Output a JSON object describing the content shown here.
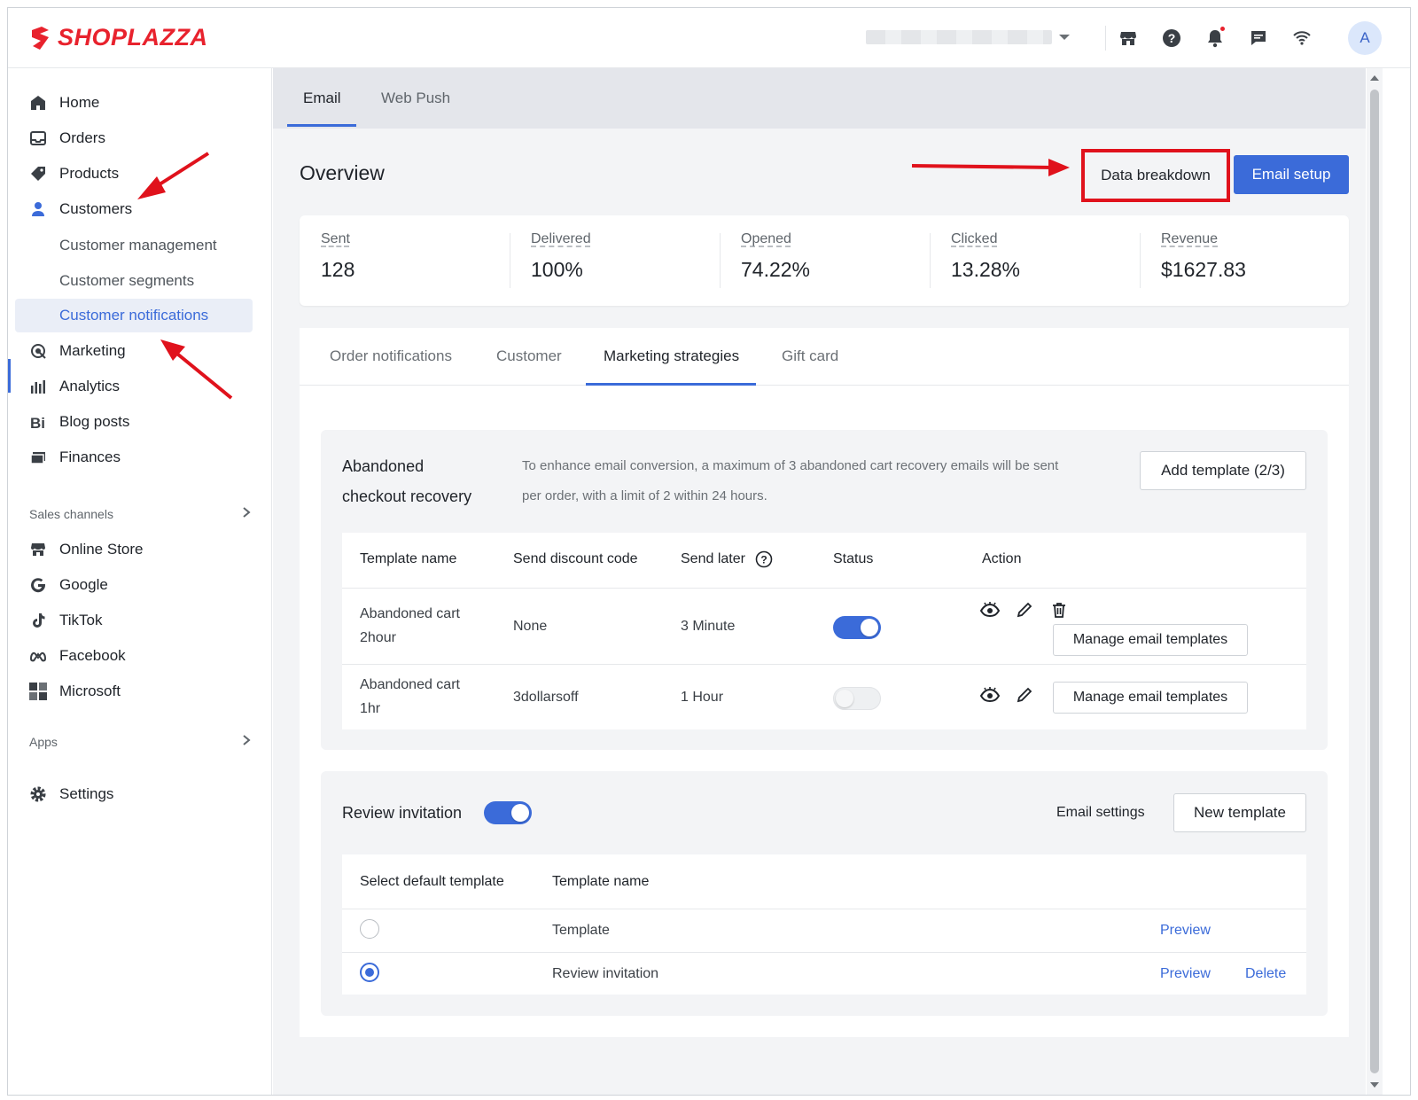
{
  "brand": {
    "name": "SHOPLAZZA",
    "color": "#e8222d",
    "accent": "#3b6bd9"
  },
  "header": {
    "icons": [
      "store-icon",
      "help-icon",
      "bell-icon",
      "chat-icon",
      "wifi-icon"
    ],
    "avatar_initial": "A"
  },
  "sidebar": {
    "items": [
      {
        "label": "Home",
        "icon": "home-icon"
      },
      {
        "label": "Orders",
        "icon": "orders-icon"
      },
      {
        "label": "Products",
        "icon": "tag-icon"
      },
      {
        "label": "Customers",
        "icon": "person-icon"
      }
    ],
    "customer_sub": [
      {
        "label": "Customer management"
      },
      {
        "label": "Customer segments"
      },
      {
        "label": "Customer notifications"
      }
    ],
    "items2": [
      {
        "label": "Marketing",
        "icon": "marketing-icon"
      },
      {
        "label": "Analytics",
        "icon": "analytics-icon"
      },
      {
        "label": "Blog posts",
        "icon": "blog-icon"
      },
      {
        "label": "Finances",
        "icon": "finances-icon"
      }
    ],
    "sales_channels_label": "Sales channels",
    "channels": [
      {
        "label": "Online Store",
        "icon": "store-icon"
      },
      {
        "label": "Google",
        "icon": "google-icon"
      },
      {
        "label": "TikTok",
        "icon": "tiktok-icon"
      },
      {
        "label": "Facebook",
        "icon": "meta-icon"
      },
      {
        "label": "Microsoft",
        "icon": "microsoft-icon"
      }
    ],
    "apps_label": "Apps",
    "settings_label": "Settings"
  },
  "main": {
    "tabs": [
      {
        "label": "Email"
      },
      {
        "label": "Web Push"
      }
    ],
    "overview_title": "Overview",
    "data_breakdown_label": "Data breakdown",
    "email_setup_label": "Email setup",
    "stats": [
      {
        "label": "Sent",
        "value": "128"
      },
      {
        "label": "Delivered",
        "value": "100%"
      },
      {
        "label": "Opened",
        "value": "74.22%"
      },
      {
        "label": "Clicked",
        "value": "13.28%"
      },
      {
        "label": "Revenue",
        "value": "$1627.83"
      }
    ],
    "sub_tabs": [
      {
        "label": "Order notifications"
      },
      {
        "label": "Customer"
      },
      {
        "label": "Marketing strategies"
      },
      {
        "label": "Gift card"
      }
    ],
    "abandoned": {
      "title_line1": "Abandoned",
      "title_line2": "checkout recovery",
      "desc_line1": "To enhance email conversion, a maximum of 3 abandoned cart recovery emails will be sent",
      "desc_line2": "per order, with a limit of 2 within 24 hours.",
      "add_template_label": "Add template (2/3)",
      "columns": [
        "Template name",
        "Send discount code",
        "Send later",
        "Status",
        "Action"
      ],
      "rows": [
        {
          "name_line1": "Abandoned cart",
          "name_line2": "2hour",
          "discount": "None",
          "send_later": "3 Minute",
          "status_on": true,
          "manage_label": "Manage email templates"
        },
        {
          "name_line1": "Abandoned cart",
          "name_line2": "1hr",
          "discount": "3dollarsoff",
          "send_later": "1 Hour",
          "status_on": false,
          "manage_label": "Manage email templates"
        }
      ]
    },
    "review": {
      "title": "Review invitation",
      "enabled": true,
      "email_settings_label": "Email settings",
      "new_template_label": "New template",
      "columns": [
        "Select default template",
        "Template name"
      ],
      "rows": [
        {
          "name": "Template",
          "selected": false,
          "preview_label": "Preview"
        },
        {
          "name": "Review invitation",
          "selected": true,
          "preview_label": "Preview",
          "delete_label": "Delete"
        }
      ]
    }
  }
}
